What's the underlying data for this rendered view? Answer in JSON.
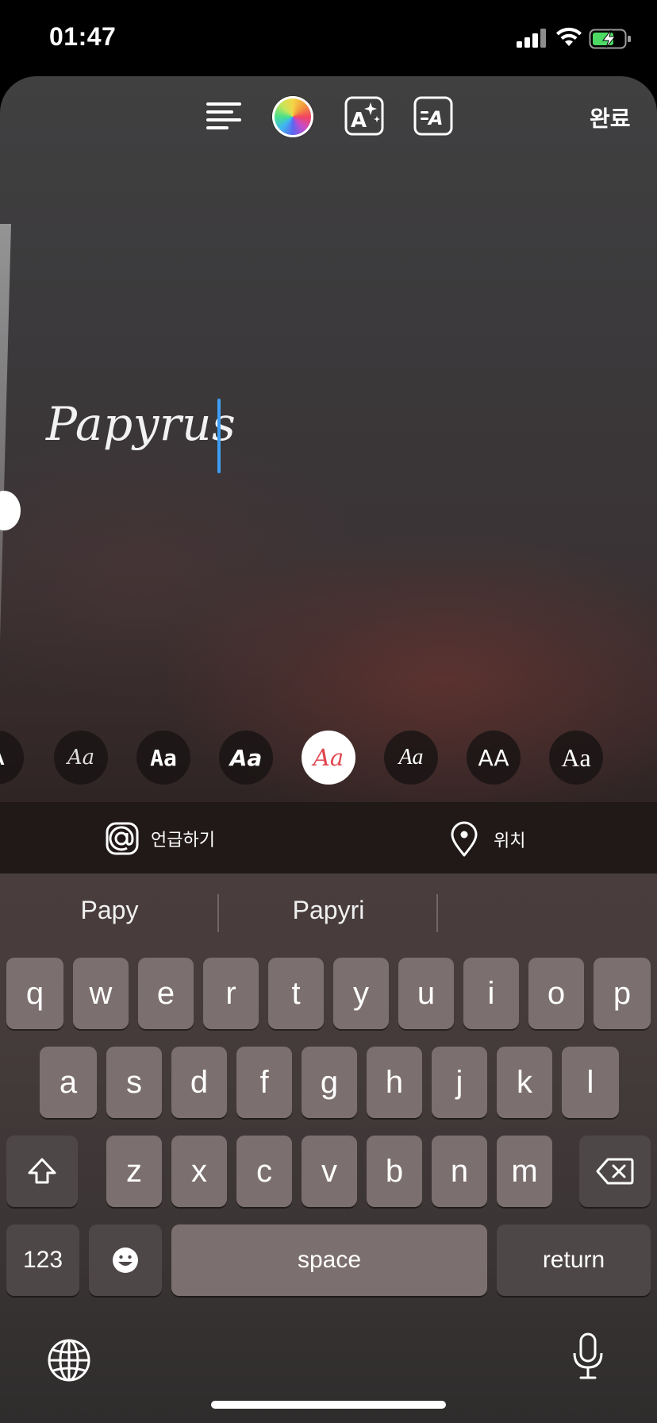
{
  "status_bar": {
    "time": "01:47",
    "icons": [
      "signal-icon",
      "wifi-icon",
      "battery-charging-icon"
    ]
  },
  "toolbar": {
    "align_icon": "align-left-icon",
    "color_icon": "color-wheel-icon",
    "effect_icon": "text-effect-sparkle-icon",
    "animate_icon": "text-animate-icon",
    "done_label": "완료"
  },
  "editor": {
    "text": "Papyrus",
    "cursor_color": "#3d9ef5"
  },
  "font_picker": {
    "fonts": [
      {
        "label": "A",
        "selected": false
      },
      {
        "label": "Aa",
        "selected": false
      },
      {
        "label": "Aa",
        "selected": false
      },
      {
        "label": "Aa",
        "selected": false
      },
      {
        "label": "Aa",
        "selected": true
      },
      {
        "label": "Aa",
        "selected": false
      },
      {
        "label": "AA",
        "selected": false
      },
      {
        "label": "Aa",
        "selected": false
      }
    ],
    "selected_color": "#e0454f"
  },
  "actions": {
    "mention_label": "언급하기",
    "mention_icon": "at-sign-icon",
    "location_label": "위치",
    "location_icon": "location-pin-icon"
  },
  "keyboard": {
    "suggestions": [
      "Papy",
      "Papyri",
      ""
    ],
    "row1": [
      "q",
      "w",
      "e",
      "r",
      "t",
      "y",
      "u",
      "i",
      "o",
      "p"
    ],
    "row2": [
      "a",
      "s",
      "d",
      "f",
      "g",
      "h",
      "j",
      "k",
      "l"
    ],
    "row3": [
      "z",
      "x",
      "c",
      "v",
      "b",
      "n",
      "m"
    ],
    "shift_icon": "shift-icon",
    "backspace_icon": "backspace-icon",
    "numbers_label": "123",
    "emoji_icon": "emoji-icon",
    "space_label": "space",
    "return_label": "return",
    "globe_icon": "globe-icon",
    "mic_icon": "microphone-icon"
  }
}
